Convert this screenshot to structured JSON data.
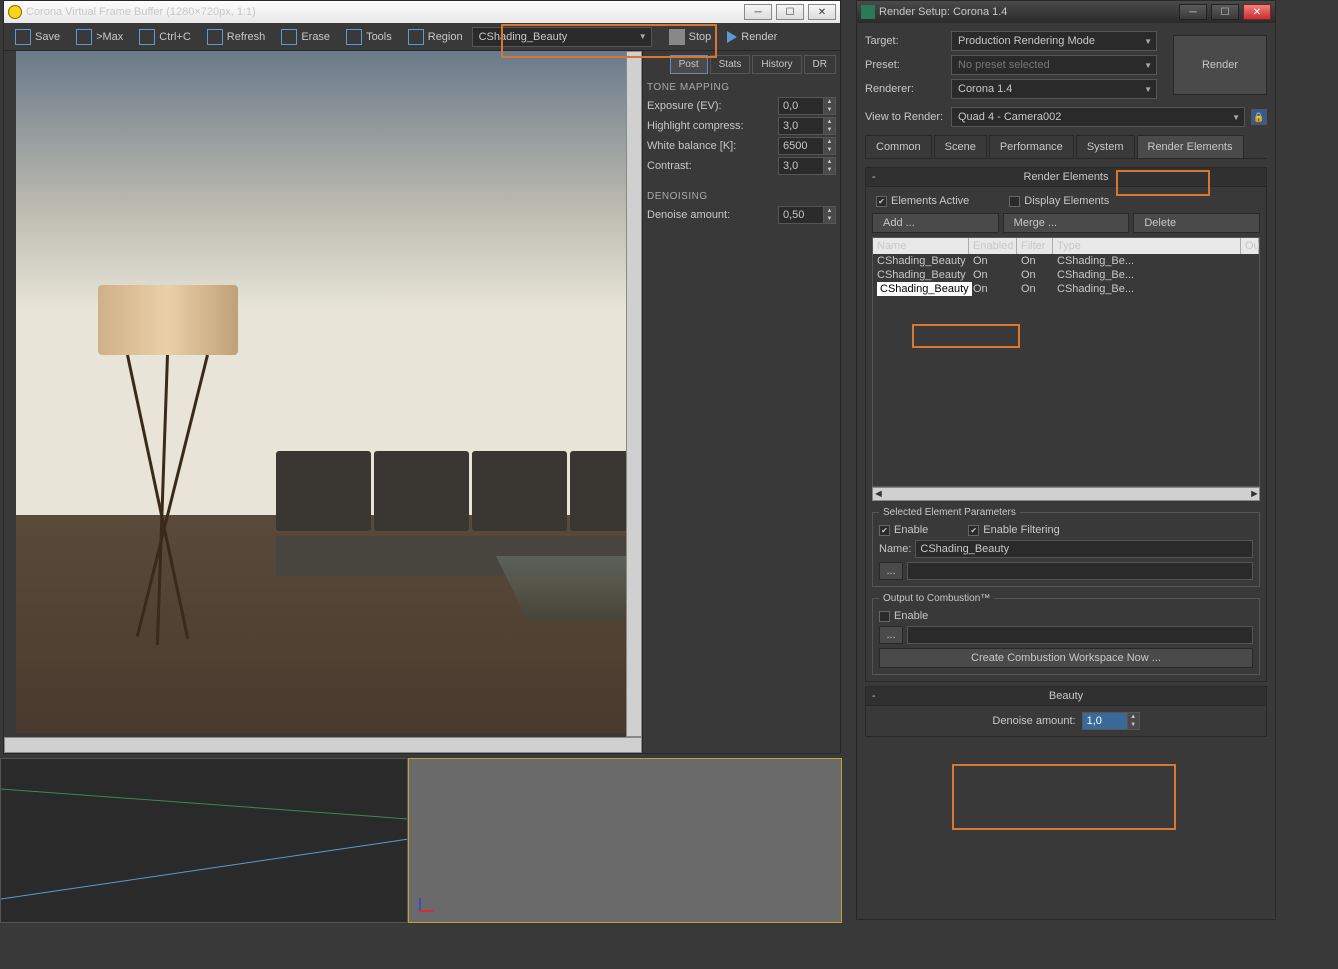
{
  "vfb": {
    "title": "Corona Virtual Frame Buffer (1280×720px, 1:1)",
    "toolbar": {
      "save": "Save",
      "max": ">Max",
      "ctrlc": "Ctrl+C",
      "refresh": "Refresh",
      "erase": "Erase",
      "tools": "Tools",
      "region": "Region",
      "channel": "CShading_Beauty",
      "stop": "Stop",
      "render": "Render"
    },
    "tabs": {
      "post": "Post",
      "stats": "Stats",
      "history": "History",
      "dr": "DR"
    },
    "tonemapping": {
      "heading": "TONE MAPPING",
      "exposure_l": "Exposure (EV):",
      "exposure_v": "0,0",
      "highlight_l": "Highlight compress:",
      "highlight_v": "3,0",
      "wb_l": "White balance [K]:",
      "wb_v": "6500",
      "contrast_l": "Contrast:",
      "contrast_v": "3,0"
    },
    "denoising": {
      "heading": "DENOISING",
      "amount_l": "Denoise amount:",
      "amount_v": "0,50"
    }
  },
  "setup": {
    "title": "Render Setup: Corona 1.4",
    "target_l": "Target:",
    "target_v": "Production Rendering Mode",
    "preset_l": "Preset:",
    "preset_v": "No preset selected",
    "renderer_l": "Renderer:",
    "renderer_v": "Corona 1.4",
    "view_l": "View to Render:",
    "view_v": "Quad 4 - Camera002",
    "render_btn": "Render",
    "tabs": {
      "common": "Common",
      "scene": "Scene",
      "perf": "Performance",
      "system": "System",
      "re": "Render Elements"
    },
    "re": {
      "heading": "Render Elements",
      "elements_active": "Elements Active",
      "display_elements": "Display Elements",
      "add": "Add ...",
      "merge": "Merge ...",
      "delete": "Delete",
      "cols": {
        "name": "Name",
        "enabled": "Enabled",
        "filter": "Filter",
        "type": "Type",
        "out": "Ou"
      },
      "rows": [
        {
          "name": "CShading_Beauty",
          "enabled": "On",
          "filter": "On",
          "type": "CShading_Be...",
          "editing": false
        },
        {
          "name": "CShading_Beauty",
          "enabled": "On",
          "filter": "On",
          "type": "CShading_Be...",
          "editing": false
        },
        {
          "name": "CShading_Beauty",
          "enabled": "On",
          "filter": "On",
          "type": "CShading_Be...",
          "editing": true
        }
      ]
    },
    "sel_params": {
      "heading": "Selected Element Parameters",
      "enable": "Enable",
      "enable_filtering": "Enable Filtering",
      "name_l": "Name:",
      "name_v": "CShading_Beauty"
    },
    "combustion": {
      "heading": "Output to Combustion™",
      "enable": "Enable",
      "create": "Create Combustion Workspace Now ..."
    },
    "beauty": {
      "heading": "Beauty",
      "denoise_l": "Denoise amount:",
      "denoise_v": "1,0"
    }
  },
  "browse": "...",
  "minus": "-"
}
